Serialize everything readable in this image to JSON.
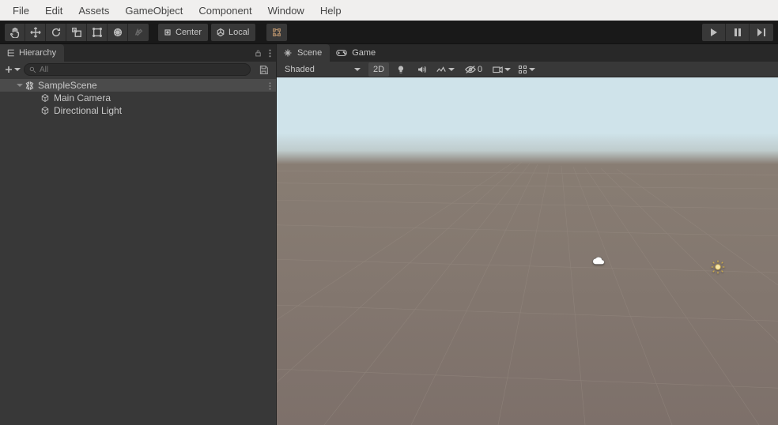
{
  "menubar": [
    "File",
    "Edit",
    "Assets",
    "GameObject",
    "Component",
    "Window",
    "Help"
  ],
  "toolbar": {
    "pivot_center": "Center",
    "pivot_local": "Local"
  },
  "hierarchy": {
    "tab": "Hierarchy",
    "search_placeholder": "All",
    "scene": "SampleScene",
    "objects": [
      "Main Camera",
      "Directional Light"
    ]
  },
  "scene": {
    "tab_scene": "Scene",
    "tab_game": "Game",
    "shading_mode": "Shaded",
    "toggle2d": "2D",
    "gizmo_visibility_count": "0"
  }
}
